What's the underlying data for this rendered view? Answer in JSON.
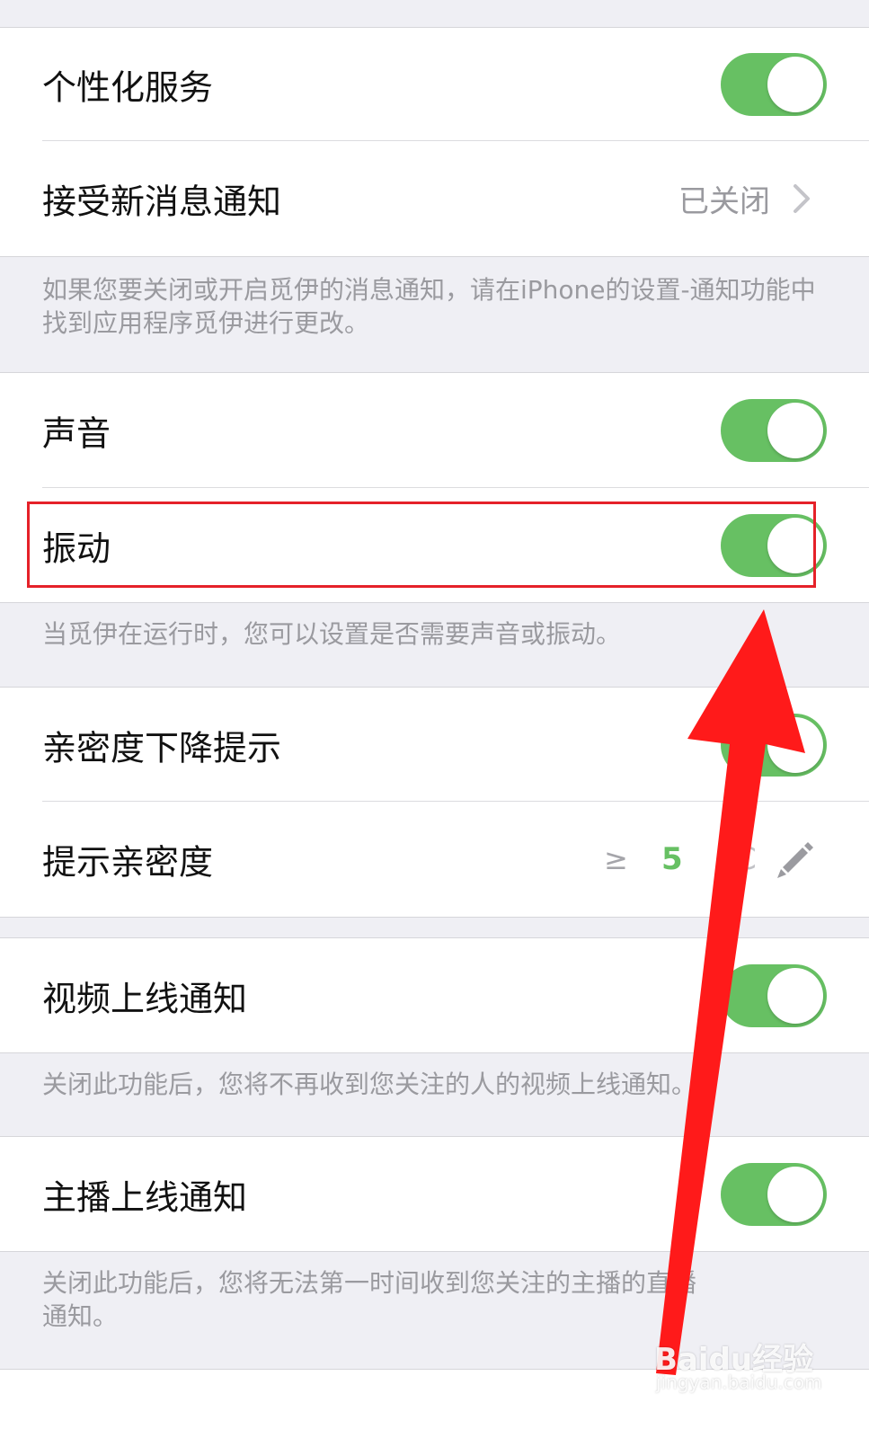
{
  "rows": {
    "personalized": {
      "label": "个性化服务",
      "on": true
    },
    "new_message": {
      "label": "接受新消息通知",
      "status": "已关闭"
    },
    "sound": {
      "label": "声音",
      "on": true
    },
    "vibrate": {
      "label": "振动",
      "on": true
    },
    "intimacy_drop": {
      "label": "亲密度下降提示",
      "on": true
    },
    "intimacy_threshold": {
      "label": "提示亲密度",
      "operator": "≥",
      "value": "5",
      "partial_glyph": "C"
    },
    "video_online": {
      "label": "视频上线通知",
      "on": true
    },
    "host_online": {
      "label": "主播上线通知",
      "on": true
    }
  },
  "notes": {
    "notify_hint": "如果您要关闭或开启觅伊的消息通知，请在iPhone的设置-通知功能中找到应用程序觅伊进行更改。",
    "sound_hint": "当觅伊在运行时，您可以设置是否需要声音或振动。",
    "video_hint": "关闭此功能后，您将不再收到您关注的人的视频上线通知。",
    "host_hint": "关闭此功能后，您将无法第一时间收到您关注的主播的直播通知。"
  },
  "watermark": {
    "brand": "Baidu经验",
    "url": "jingyan.baidu.com"
  },
  "colors": {
    "toggle_on": "#67c063",
    "highlight": "#e52129",
    "arrow": "#ff0000",
    "group_background": "#efeff4"
  }
}
